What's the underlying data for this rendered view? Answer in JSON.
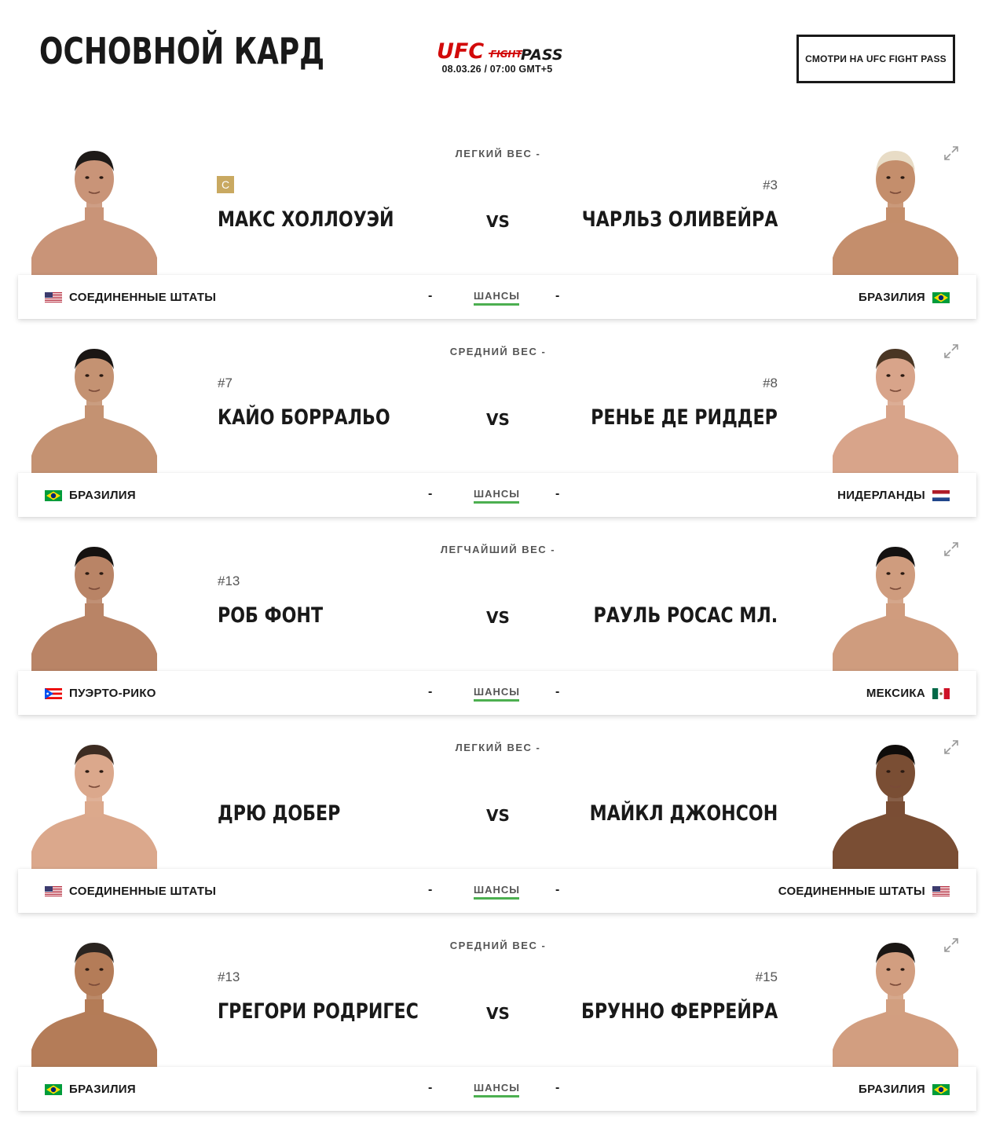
{
  "header": {
    "title": "ОСНОВНОЙ КАРД",
    "logo_text_ufc": "UFC",
    "logo_text_fight": "FIGHT",
    "logo_text_pass": "PASS",
    "event_date": "08.03.26 / 07:00 GMT+5",
    "watch_button": "СМОТРИ НА UFC FIGHT PASS"
  },
  "colors": {
    "accent_red": "#d20a0a",
    "odds_underline": "#4caf50",
    "champ_gold": "#c9a961"
  },
  "fights": [
    {
      "weight_class": "ЛЕГКИЙ ВЕС -",
      "red": {
        "name": "МАКС ХОЛЛОУЭЙ",
        "rank": "C",
        "champion": true,
        "country": "СОЕДИНЕННЫЕ ШТАТЫ",
        "flag": "us-flag-icon",
        "odds": "-"
      },
      "blue": {
        "name": "ЧАРЛЬЗ ОЛИВЕЙРА",
        "rank": "#3",
        "country": "БРАЗИЛИЯ",
        "flag": "br-flag-icon",
        "odds": "-"
      },
      "vs": "VS",
      "odds_label": "ШАНСЫ"
    },
    {
      "weight_class": "СРЕДНИЙ ВЕС -",
      "red": {
        "name": "КАЙО БОРРАЛЬО",
        "rank": "#7",
        "champion": false,
        "country": "БРАЗИЛИЯ",
        "flag": "br-flag-icon",
        "odds": "-"
      },
      "blue": {
        "name": "РЕНЬЕ ДЕ РИДДЕР",
        "rank": "#8",
        "country": "НИДЕРЛАНДЫ",
        "flag": "nl-flag-icon",
        "odds": "-"
      },
      "vs": "VS",
      "odds_label": "ШАНСЫ"
    },
    {
      "weight_class": "ЛЕГЧАЙШИЙ ВЕС -",
      "red": {
        "name": "РОБ ФОНТ",
        "rank": "#13",
        "champion": false,
        "country": "ПУЭРТО-РИКО",
        "flag": "pr-flag-icon",
        "odds": "-"
      },
      "blue": {
        "name": "РАУЛЬ РОСАС МЛ.",
        "rank": "",
        "country": "МЕКСИКА",
        "flag": "mx-flag-icon",
        "odds": "-"
      },
      "vs": "VS",
      "odds_label": "ШАНСЫ"
    },
    {
      "weight_class": "ЛЕГКИЙ ВЕС -",
      "red": {
        "name": "ДРЮ ДОБЕР",
        "rank": "",
        "champion": false,
        "country": "СОЕДИНЕННЫЕ ШТАТЫ",
        "flag": "us-flag-icon",
        "odds": "-"
      },
      "blue": {
        "name": "МАЙКЛ ДЖОНСОН",
        "rank": "",
        "country": "СОЕДИНЕННЫЕ ШТАТЫ",
        "flag": "us-flag-icon",
        "odds": "-"
      },
      "vs": "VS",
      "odds_label": "ШАНСЫ"
    },
    {
      "weight_class": "СРЕДНИЙ ВЕС -",
      "red": {
        "name": "ГРЕГОРИ РОДРИГЕС",
        "rank": "#13",
        "champion": false,
        "country": "БРАЗИЛИЯ",
        "flag": "br-flag-icon",
        "odds": "-"
      },
      "blue": {
        "name": "БРУННО ФЕРРЕЙРА",
        "rank": "#15",
        "country": "БРАЗИЛИЯ",
        "flag": "br-flag-icon",
        "odds": "-"
      },
      "vs": "VS",
      "odds_label": "ШАНСЫ"
    }
  ]
}
